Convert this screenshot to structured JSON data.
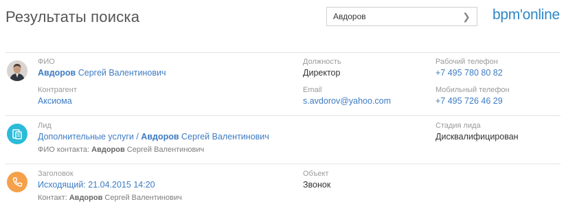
{
  "header": {
    "title": "Результаты поиска",
    "search_value": "Авдоров",
    "logo": "bpm'online"
  },
  "results": {
    "contact": {
      "name_label": "ФИО",
      "name_bold": "Авдоров",
      "name_rest": " Сергей Валентинович",
      "account_label": "Контрагент",
      "account_value": "Аксиома",
      "job_label": "Должность",
      "job_value": "Директор",
      "email_label": "Email",
      "email_value": "s.avdorov@yahoo.com",
      "work_phone_label": "Рабочий телефон",
      "work_phone_value": "+7 495 780 80 82",
      "mobile_label": "Мобильный телефон",
      "mobile_value": "+7 495 726 46 29"
    },
    "lead": {
      "label": "Лид",
      "title_prefix": "Дополнительные услуги / ",
      "title_bold": "Авдоров",
      "title_rest": " Сергей Валентинович",
      "contact_label": "ФИО контакта:",
      "contact_bold": "Авдоров",
      "contact_rest": " Сергей Валентинович",
      "stage_label": "Стадия лида",
      "stage_value": "Дисквалифицирован"
    },
    "activity": {
      "label": "Заголовок",
      "title": "Исходящий: 21.04.2015 14:20",
      "contact_label": "Контакт:",
      "contact_bold": "Авдоров",
      "contact_rest": " Сергей Валентинович",
      "object_label": "Объект",
      "object_value": "Звонок"
    }
  },
  "colors": {
    "link": "#3d7bc3",
    "logo": "#2e87c6",
    "lead_icon": "#2bbbd8",
    "call_icon": "#f5a04a"
  }
}
